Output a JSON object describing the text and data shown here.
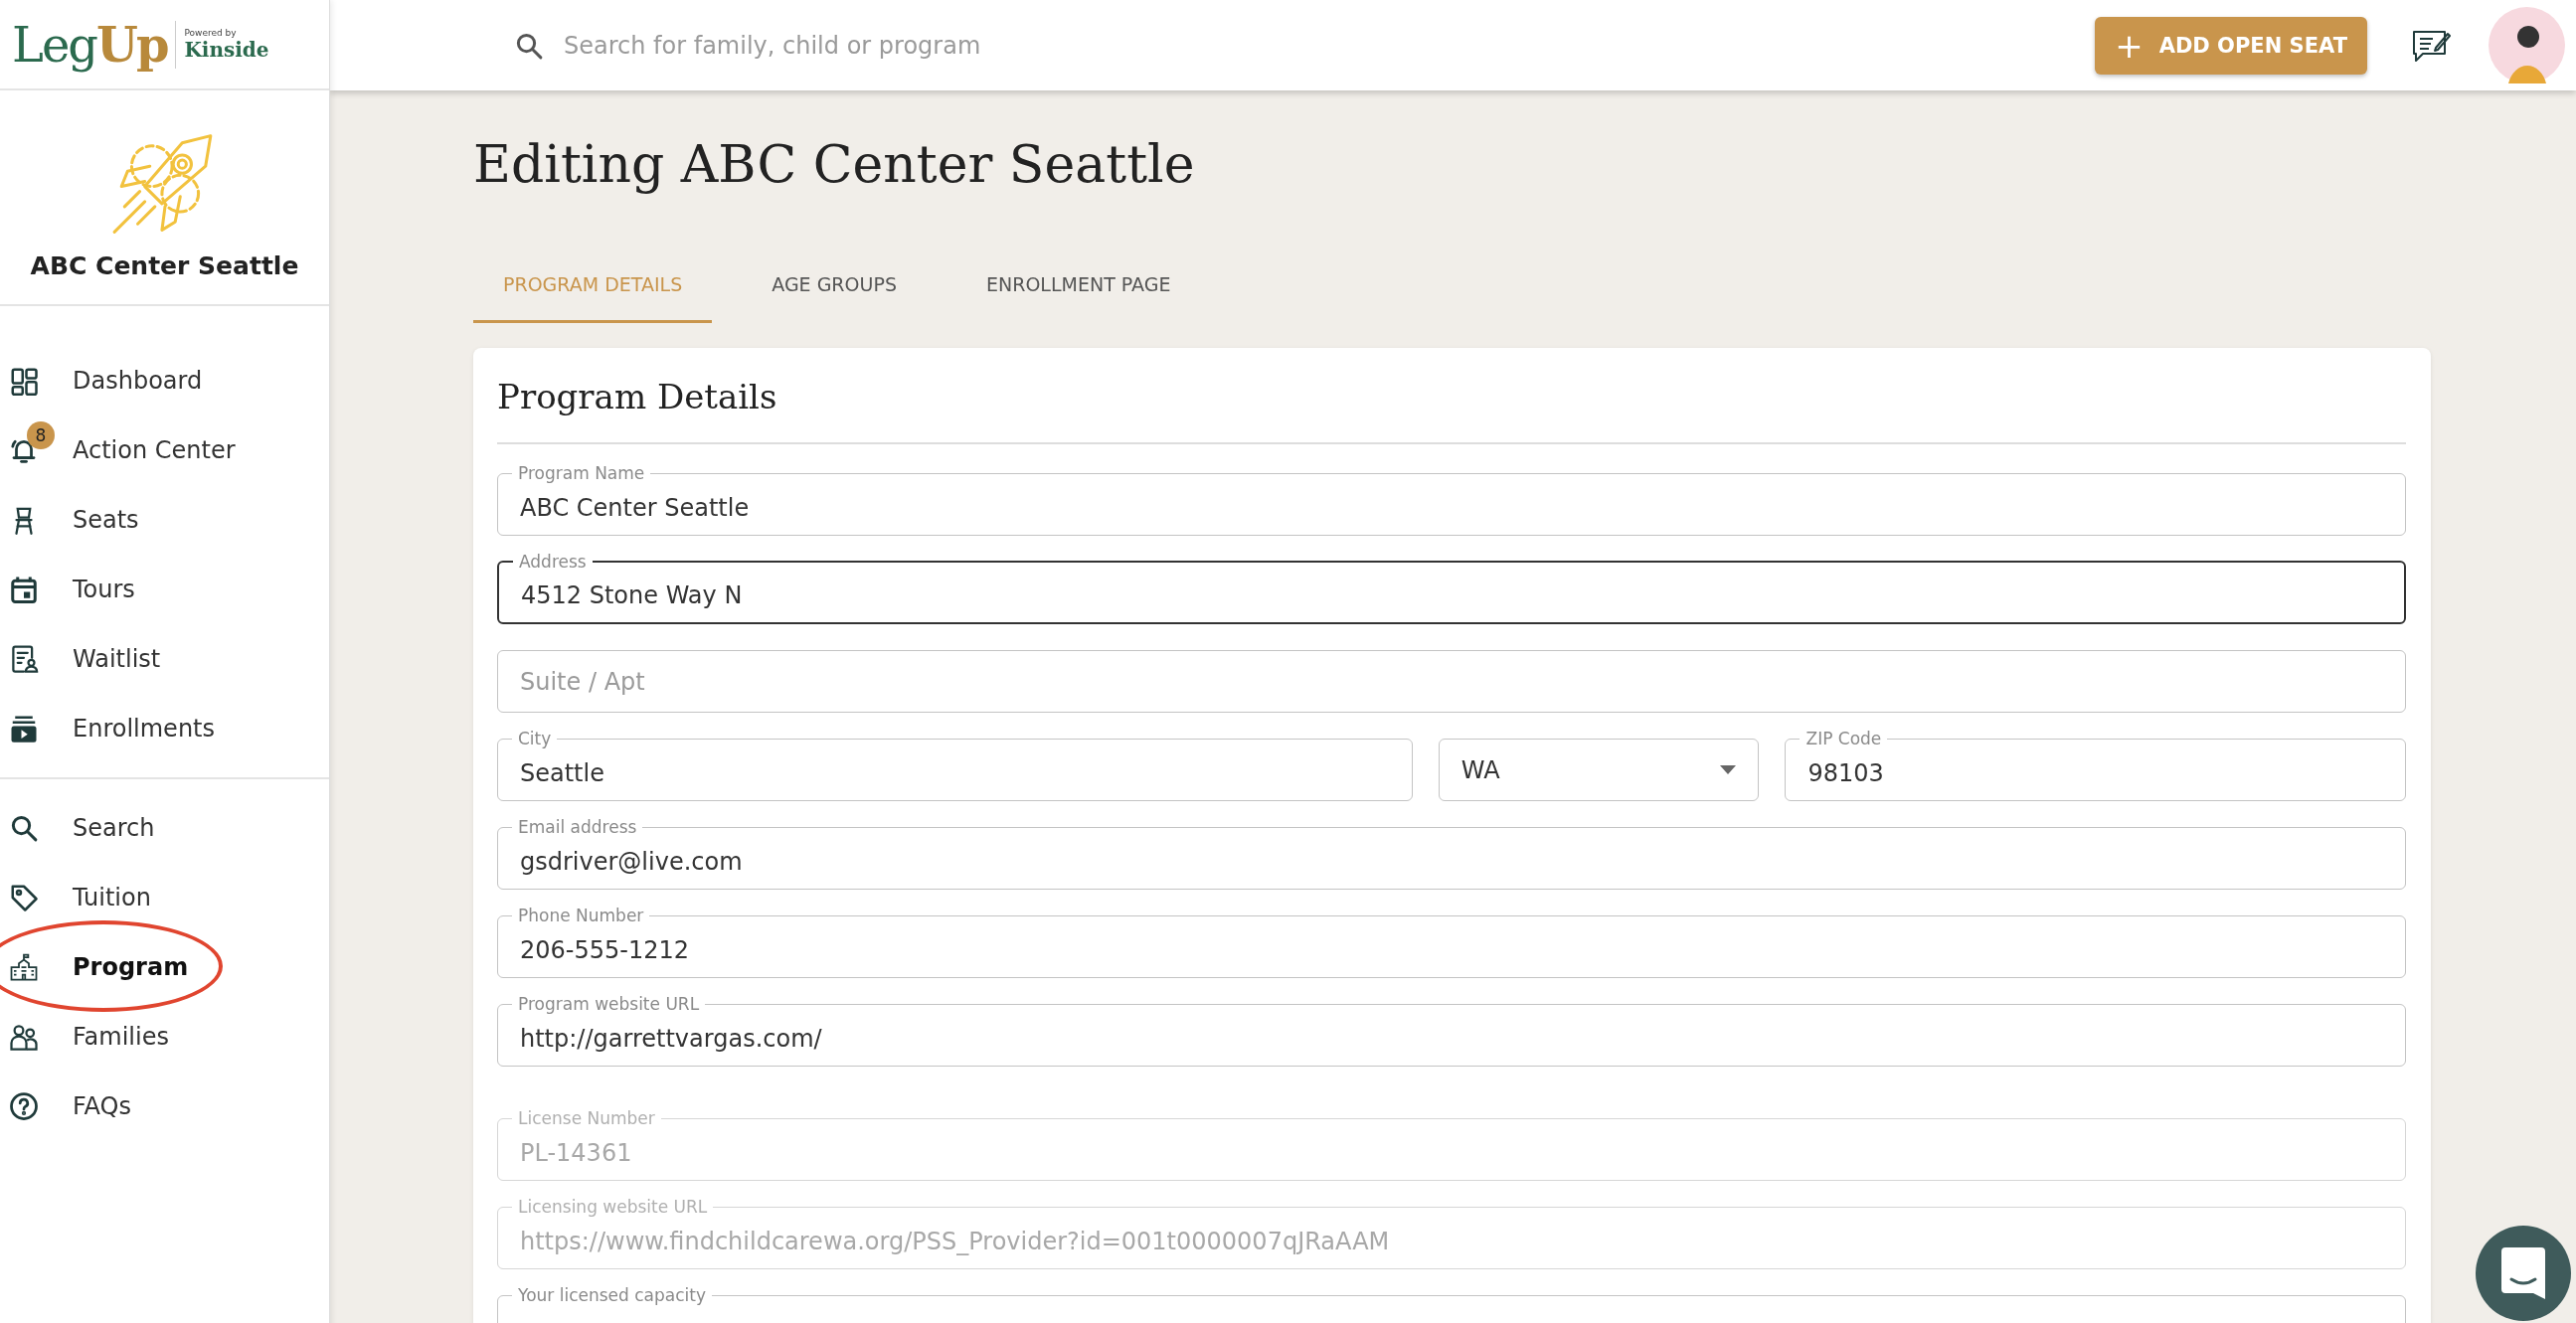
{
  "brand": {
    "logo_primary": "Leg",
    "logo_accent": "Up",
    "powered_by": "Powered by",
    "partner": "Kinside"
  },
  "search": {
    "placeholder": "Search for family, child or program"
  },
  "add_button": {
    "icon": "+",
    "label": "ADD OPEN SEAT"
  },
  "program_card": {
    "name": "ABC Center Seattle"
  },
  "nav_sections": [
    {
      "items": [
        {
          "kind": "dashboard",
          "label": "Dashboard",
          "selected": false,
          "highlighted": false
        },
        {
          "kind": "bell",
          "label": "Action Center",
          "selected": false,
          "highlighted": false,
          "badge": "8"
        },
        {
          "kind": "chair",
          "label": "Seats",
          "selected": false,
          "highlighted": false
        },
        {
          "kind": "calendar",
          "label": "Tours",
          "selected": false,
          "highlighted": false
        },
        {
          "kind": "waitlist",
          "label": "Waitlist",
          "selected": false,
          "highlighted": false
        },
        {
          "kind": "enrollments",
          "label": "Enrollments",
          "selected": false,
          "highlighted": false
        }
      ]
    },
    {
      "items": [
        {
          "kind": "search",
          "label": "Search",
          "selected": false,
          "highlighted": false
        },
        {
          "kind": "tag",
          "label": "Tuition",
          "selected": false,
          "highlighted": false
        },
        {
          "kind": "school",
          "label": "Program",
          "selected": true,
          "highlighted": true
        },
        {
          "kind": "people",
          "label": "Families",
          "selected": false,
          "highlighted": false
        },
        {
          "kind": "help",
          "label": "FAQs",
          "selected": false,
          "highlighted": false
        }
      ]
    }
  ],
  "page": {
    "title": "Editing ABC Center Seattle",
    "tabs": [
      {
        "label": "PROGRAM DETAILS",
        "selected": true
      },
      {
        "label": "AGE GROUPS",
        "selected": false
      },
      {
        "label": "ENROLLMENT PAGE",
        "selected": false
      }
    ],
    "form": {
      "heading": "Program Details",
      "sections": [
        {
          "rows": [
            {
              "fields": [
                {
                  "kind": "text",
                  "label": "Program Name",
                  "value": "ABC Center Seattle",
                  "focused": false,
                  "disabled": false
                }
              ]
            },
            {
              "fields": [
                {
                  "kind": "text",
                  "label": "Address",
                  "value": "4512 Stone Way N",
                  "focused": true,
                  "disabled": false
                }
              ]
            },
            {
              "fields": [
                {
                  "kind": "text",
                  "placeholder": "Suite / Apt",
                  "focused": false,
                  "disabled": false
                }
              ]
            },
            {
              "fields": [
                {
                  "kind": "text",
                  "label": "City",
                  "value": "Seattle",
                  "focused": false,
                  "disabled": false
                },
                {
                  "kind": "select",
                  "value": "WA",
                  "focused": false,
                  "disabled": false
                },
                {
                  "kind": "text",
                  "label": "ZIP Code",
                  "value": "98103",
                  "focused": false,
                  "disabled": false
                }
              ]
            },
            {
              "fields": [
                {
                  "kind": "text",
                  "label": "Email address",
                  "value": "gsdriver@live.com",
                  "focused": false,
                  "disabled": false
                }
              ]
            },
            {
              "fields": [
                {
                  "kind": "text",
                  "label": "Phone Number",
                  "value": "206-555-1212",
                  "focused": false,
                  "disabled": false
                }
              ]
            },
            {
              "fields": [
                {
                  "kind": "text",
                  "label": "Program website URL",
                  "value": "http://garrettvargas.com/",
                  "focused": false,
                  "disabled": false
                }
              ]
            }
          ]
        },
        {
          "rows": [
            {
              "fields": [
                {
                  "kind": "text",
                  "label": "License Number",
                  "value": "PL-14361",
                  "focused": false,
                  "disabled": true
                }
              ]
            },
            {
              "fields": [
                {
                  "kind": "text",
                  "label": "Licensing website URL",
                  "value": "https://www.findchildcarewa.org/PSS_Provider?id=001t0000007qJRaAAM",
                  "focused": false,
                  "disabled": true
                }
              ]
            },
            {
              "fields": [
                {
                  "kind": "text",
                  "label": "Your licensed capacity",
                  "focused": false,
                  "disabled": false
                }
              ]
            }
          ]
        }
      ]
    }
  }
}
